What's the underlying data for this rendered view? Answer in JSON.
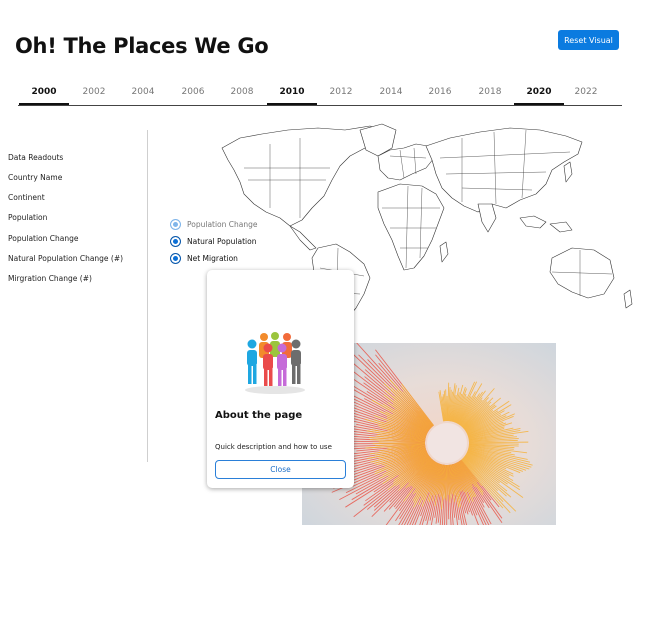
{
  "app": {
    "title": "Oh! The Places We Go",
    "reset_label": "Reset Visual"
  },
  "timeline": {
    "years": [
      "2000",
      "2002",
      "2004",
      "2006",
      "2008",
      "2010",
      "2012",
      "2014",
      "2016",
      "2018",
      "2020",
      "2022"
    ],
    "highlighted": [
      "2000",
      "2010",
      "2020"
    ]
  },
  "readouts": {
    "items": [
      "Data Readouts",
      "Country Name",
      "Continent",
      "Population",
      "Population Change",
      "Natural Population Change (#)",
      "Mirgration Change (#)"
    ]
  },
  "options": {
    "items": [
      {
        "label": "Population Change",
        "faded": true
      },
      {
        "label": "Natural Population",
        "faded": false
      },
      {
        "label": "Net Migration",
        "faded": false
      }
    ]
  },
  "modal": {
    "title": "About the page",
    "description": "Quick description and how to use",
    "close_label": "Close"
  },
  "colors": {
    "accent": "#0b7be0",
    "spiral_outer": "#e8584d",
    "spiral_inner": "#f6b23a"
  }
}
